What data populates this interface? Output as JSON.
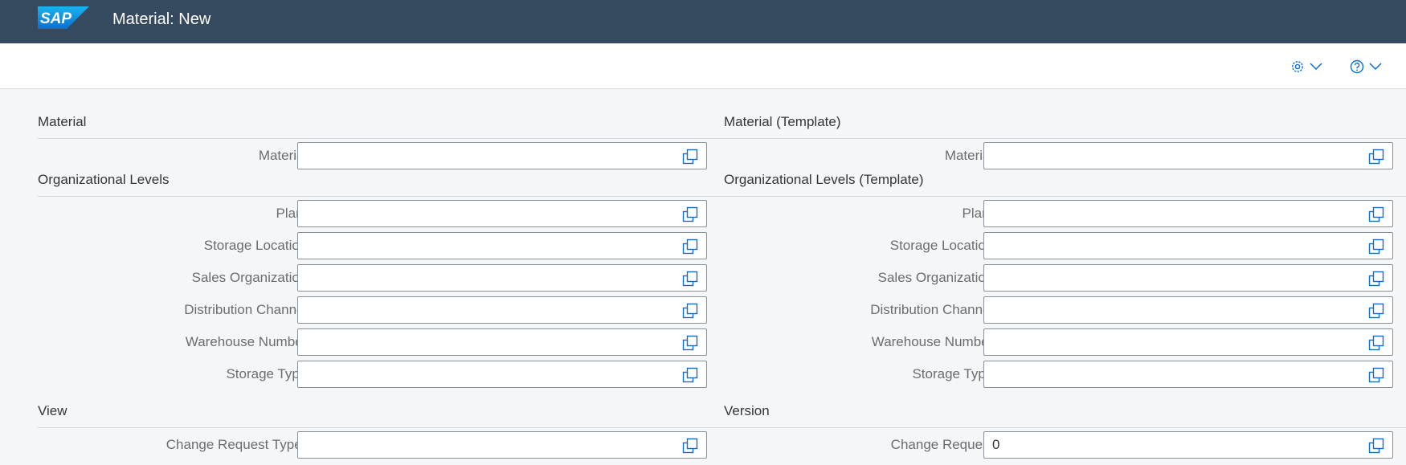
{
  "app": {
    "logo_text": "SAP",
    "title": "Material: New"
  },
  "toolbar": {
    "settings_icon": "gear-icon",
    "help_icon": "help-icon",
    "dropdown_icon": "chevron-down-icon"
  },
  "colors": {
    "shell_bg": "#354a5f",
    "page_bg": "#f5f6f7",
    "required": "#bb0000",
    "icon": "#0a6ed1"
  },
  "left": {
    "material_group": {
      "title": "Material",
      "fields": [
        {
          "label": "Material:",
          "value": ""
        }
      ]
    },
    "org_group": {
      "title": "Organizational Levels",
      "fields": [
        {
          "label": "Plant:",
          "value": ""
        },
        {
          "label": "Storage Location:",
          "value": ""
        },
        {
          "label": "Sales Organization:",
          "value": ""
        },
        {
          "label": "Distribution Channel:",
          "value": ""
        },
        {
          "label": "Warehouse Number:",
          "value": ""
        },
        {
          "label": "Storage Type:",
          "value": ""
        }
      ]
    },
    "view_group": {
      "title": "View",
      "fields": [
        {
          "label": "Change Request Type:",
          "required_marker": "*",
          "value": ""
        }
      ]
    }
  },
  "right": {
    "material_group": {
      "title": "Material (Template)",
      "fields": [
        {
          "label": "Material:",
          "value": ""
        }
      ]
    },
    "org_group": {
      "title": "Organizational Levels (Template)",
      "fields": [
        {
          "label": "Plant:",
          "value": ""
        },
        {
          "label": "Storage Location:",
          "value": ""
        },
        {
          "label": "Sales Organization:",
          "value": ""
        },
        {
          "label": "Distribution Channel:",
          "value": ""
        },
        {
          "label": "Warehouse Number:",
          "value": ""
        },
        {
          "label": "Storage Type:",
          "value": ""
        }
      ]
    },
    "version_group": {
      "title": "Version",
      "fields": [
        {
          "label": "Change Request:",
          "value": "0"
        }
      ]
    }
  }
}
